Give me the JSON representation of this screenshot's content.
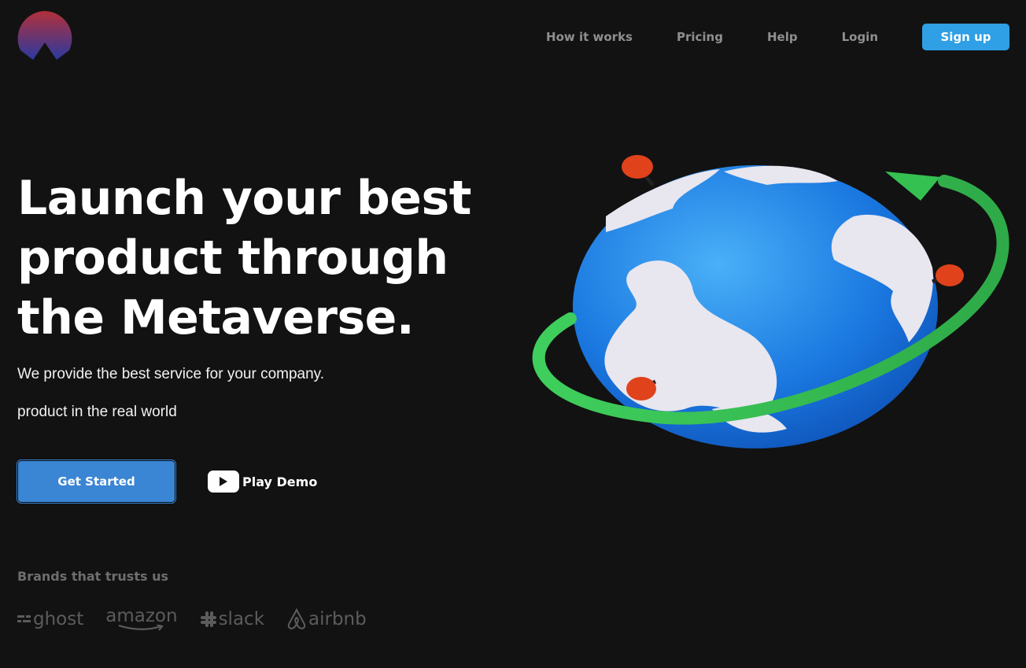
{
  "nav": {
    "links": [
      "How it works",
      "Pricing",
      "Help",
      "Login"
    ],
    "signup_label": "Sign up"
  },
  "hero": {
    "title": "Launch your best product through the Metaverse.",
    "subtitle_1": "We provide the best service for your company.",
    "subtitle_2": "product in the real world",
    "get_started_label": "Get Started",
    "play_demo_label": "Play Demo"
  },
  "brands": {
    "title": "Brands that trusts us",
    "items": [
      {
        "name": "ghost",
        "icon": "ghost-icon"
      },
      {
        "name": "amazon",
        "icon": "amazon-smile-icon"
      },
      {
        "name": "slack",
        "icon": "slack-icon"
      },
      {
        "name": "airbnb",
        "icon": "airbnb-icon"
      }
    ]
  },
  "colors": {
    "background": "#121212",
    "signup": "#2f9fe6",
    "get_started": "#3a85d4",
    "nav_link": "#8f8f8f",
    "brand_gray": "#5c5c5c"
  }
}
